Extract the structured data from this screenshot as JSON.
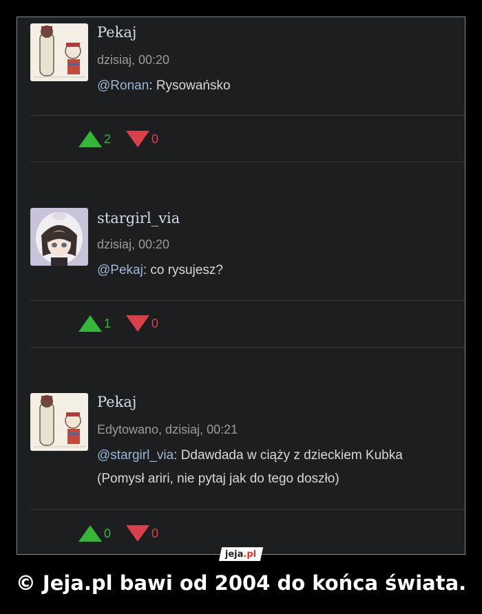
{
  "comments": [
    {
      "author": "Pekaj",
      "meta": "dzisiaj, 00:20",
      "mention": "@Ronan",
      "text": ": Rysowańsko",
      "text_line2": "",
      "upvotes": "2",
      "downvotes": "0"
    },
    {
      "author": "stargirl_via",
      "meta": "dzisiaj, 00:20",
      "mention": "@Pekaj",
      "text": ": co rysujesz?",
      "text_line2": "",
      "upvotes": "1",
      "downvotes": "0"
    },
    {
      "author": "Pekaj",
      "meta": "Edytowano, dzisiaj, 00:21",
      "mention": "@stargirl_via",
      "text": ": Ddawdada w ciąży z dzieckiem Kubka",
      "text_line2": "(Pomysł ariri, nie pytaj jak do tego doszło)",
      "upvotes": "0",
      "downvotes": "0"
    }
  ],
  "watermark": {
    "brand": "jeja",
    "tld": ".pl"
  },
  "footer": "© Jeja.pl bawi od 2004 do końca świata.",
  "colors": {
    "upvote": "#35b53a",
    "downvote": "#d8414a",
    "mention": "#9db6d6",
    "background": "#1d1e20"
  }
}
